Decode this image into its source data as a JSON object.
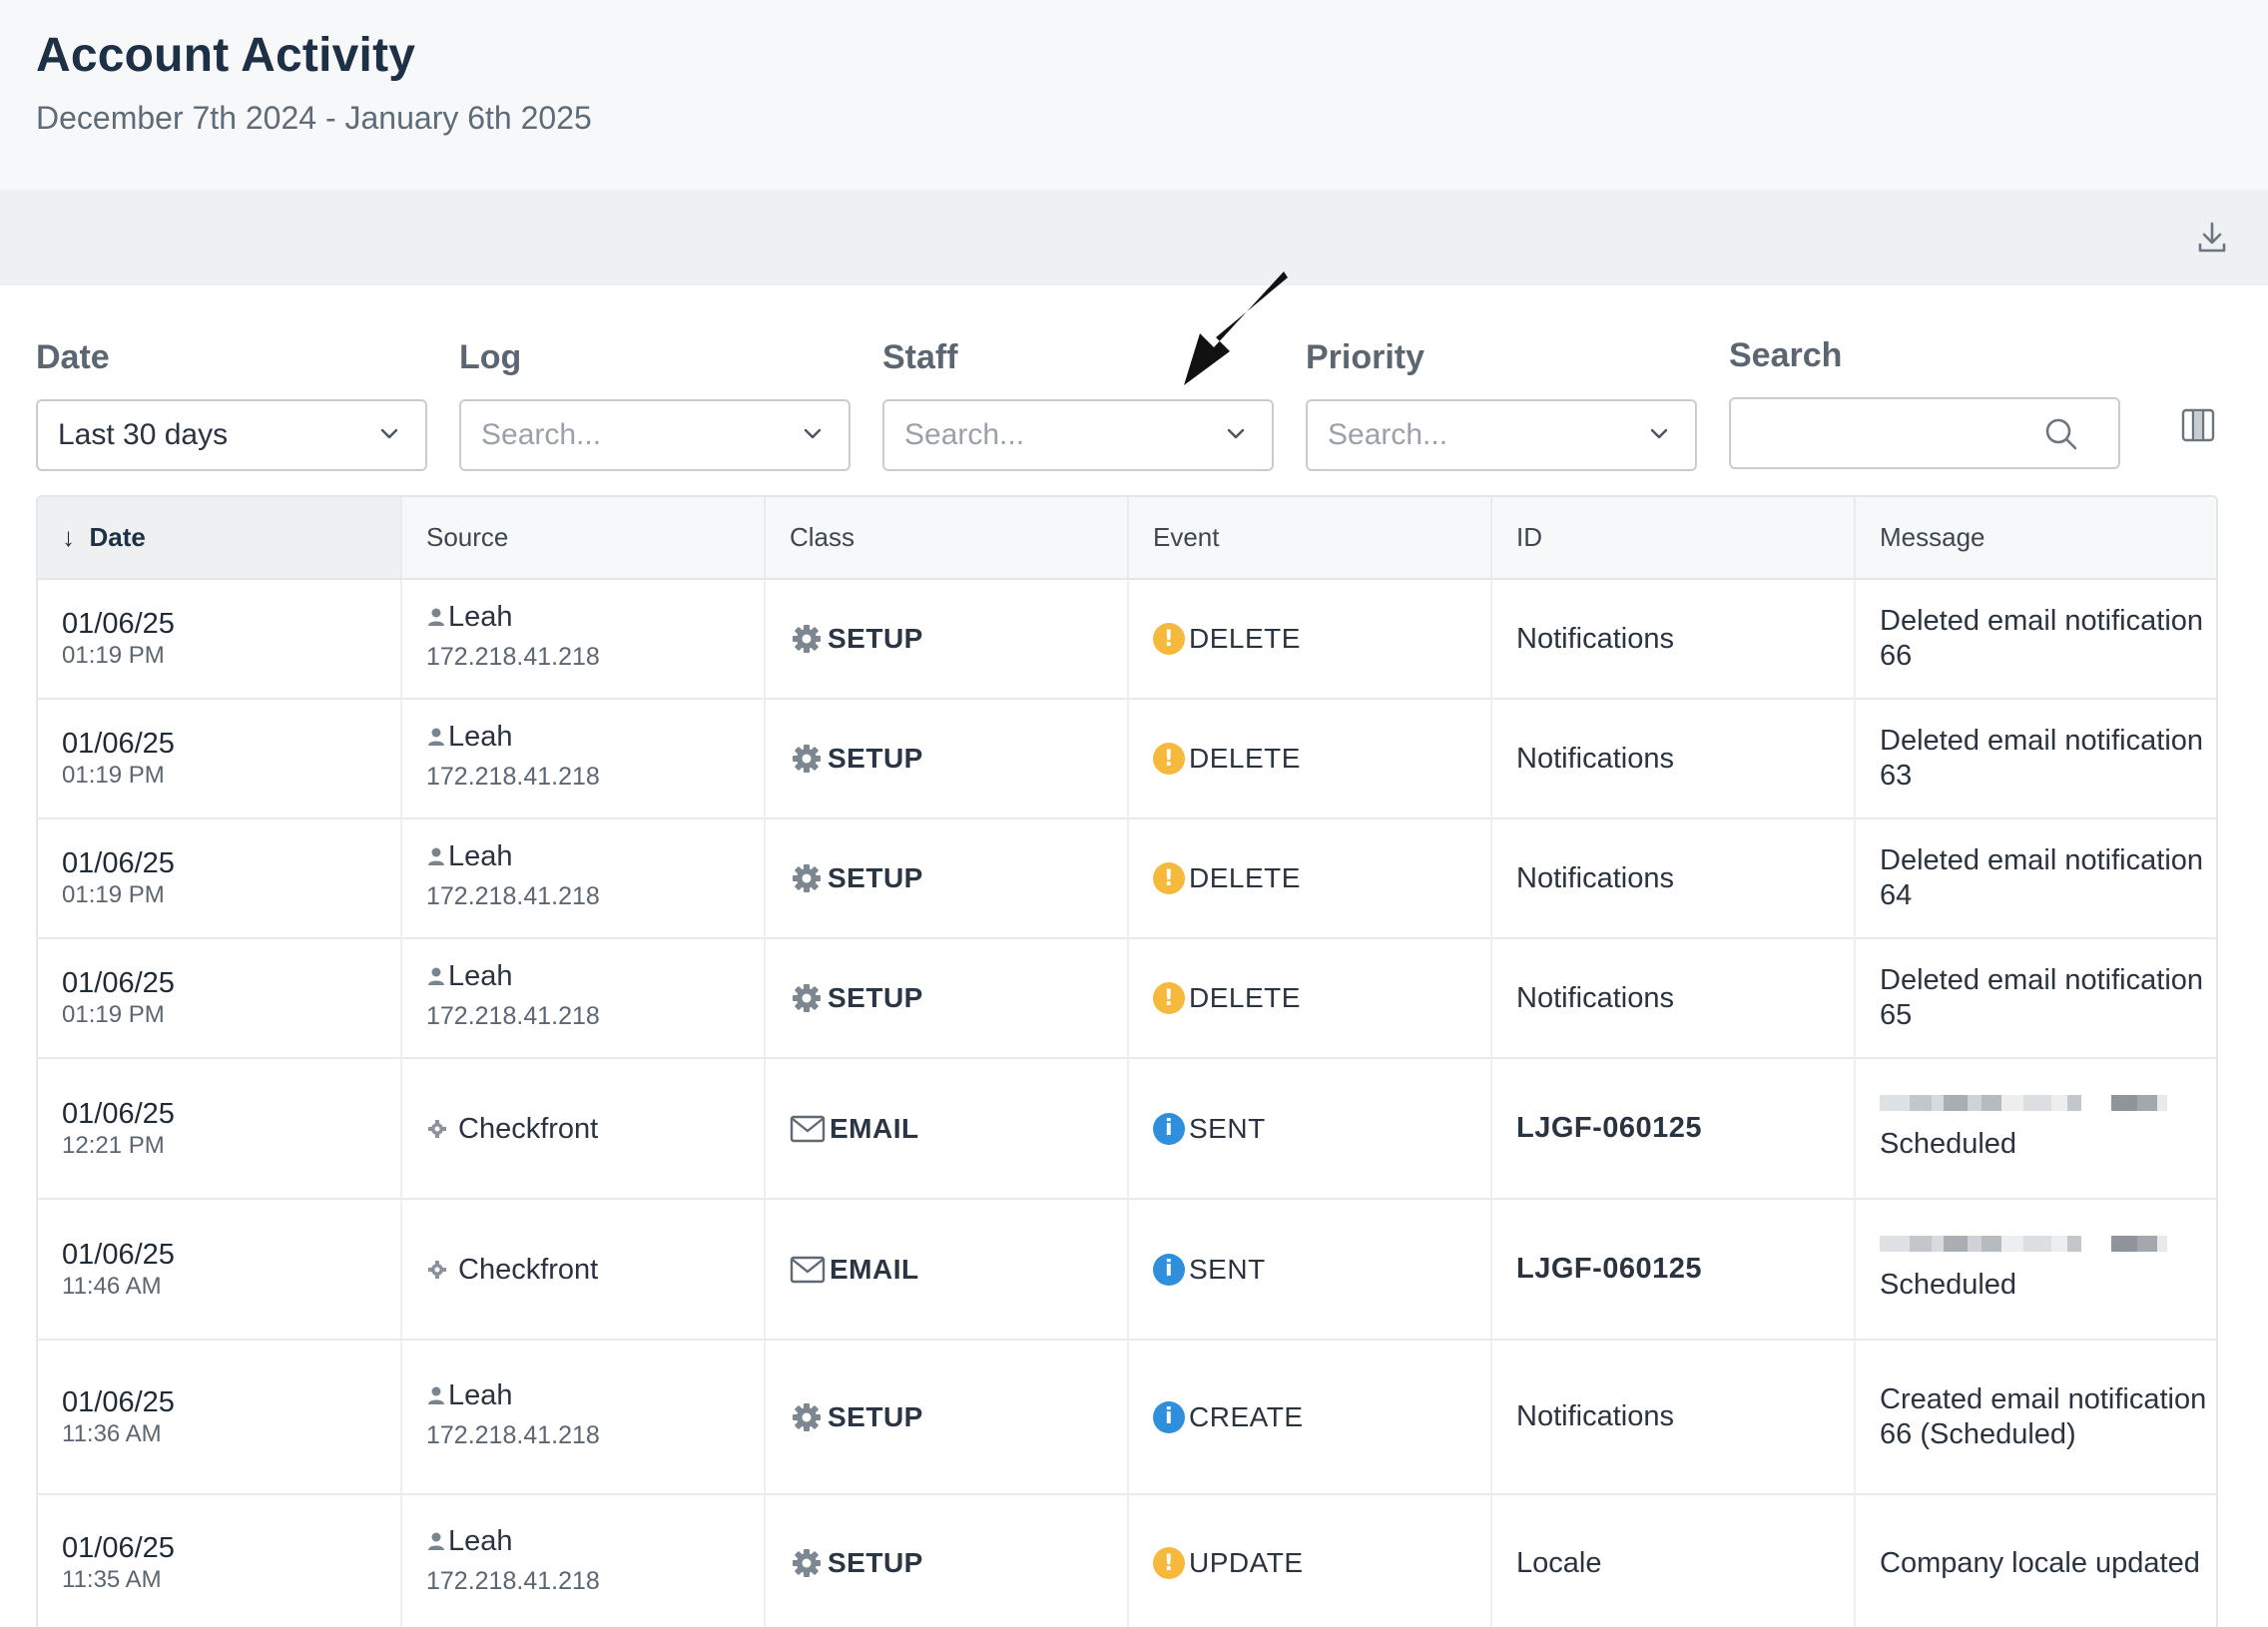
{
  "header": {
    "title": "Account Activity",
    "subtitle": "December 7th 2024 - January 6th 2025"
  },
  "toolbar": {
    "download_icon": "download-icon"
  },
  "filters": {
    "date": {
      "label": "Date",
      "value": "Last 30 days"
    },
    "log": {
      "label": "Log",
      "placeholder": "Search..."
    },
    "staff": {
      "label": "Staff",
      "placeholder": "Search..."
    },
    "priority": {
      "label": "Priority",
      "placeholder": "Search..."
    },
    "search": {
      "label": "Search",
      "value": ""
    }
  },
  "table": {
    "columns": [
      "Date",
      "Source",
      "Class",
      "Event",
      "ID",
      "Message"
    ],
    "sort_indicator": "↓",
    "rows": [
      {
        "date": "01/06/25",
        "time": "01:19 PM",
        "source": "Leah",
        "ip": "172.218.41.218",
        "source_type": "user",
        "class": "SETUP",
        "event": "DELETE",
        "event_level": "warn",
        "id": "Notifications",
        "message": "Deleted email notification 66"
      },
      {
        "date": "01/06/25",
        "time": "01:19 PM",
        "source": "Leah",
        "ip": "172.218.41.218",
        "source_type": "user",
        "class": "SETUP",
        "event": "DELETE",
        "event_level": "warn",
        "id": "Notifications",
        "message": "Deleted email notification 63"
      },
      {
        "date": "01/06/25",
        "time": "01:19 PM",
        "source": "Leah",
        "ip": "172.218.41.218",
        "source_type": "user",
        "class": "SETUP",
        "event": "DELETE",
        "event_level": "warn",
        "id": "Notifications",
        "message": "Deleted email notification 64"
      },
      {
        "date": "01/06/25",
        "time": "01:19 PM",
        "source": "Leah",
        "ip": "172.218.41.218",
        "source_type": "user",
        "class": "SETUP",
        "event": "DELETE",
        "event_level": "warn",
        "id": "Notifications",
        "message": "Deleted email notification 65"
      },
      {
        "date": "01/06/25",
        "time": "12:21 PM",
        "source": "Checkfront",
        "ip": "",
        "source_type": "system",
        "class": "EMAIL",
        "event": "SENT",
        "event_level": "info",
        "id": "LJGF-060125",
        "message": "Scheduled"
      },
      {
        "date": "01/06/25",
        "time": "11:46 AM",
        "source": "Checkfront",
        "ip": "",
        "source_type": "system",
        "class": "EMAIL",
        "event": "SENT",
        "event_level": "info",
        "id": "LJGF-060125",
        "message": "Scheduled"
      },
      {
        "date": "01/06/25",
        "time": "11:36 AM",
        "source": "Leah",
        "ip": "172.218.41.218",
        "source_type": "user",
        "class": "SETUP",
        "event": "CREATE",
        "event_level": "info",
        "id": "Notifications",
        "message": "Created email notification 66 (Scheduled)"
      },
      {
        "date": "01/06/25",
        "time": "11:35 AM",
        "source": "Leah",
        "ip": "172.218.41.218",
        "source_type": "user",
        "class": "SETUP",
        "event": "UPDATE",
        "event_level": "warn",
        "id": "Locale",
        "message": "Company locale updated"
      }
    ]
  },
  "colors": {
    "warn": "#f6b93b",
    "info": "#2f8fdd",
    "title": "#1e3045"
  }
}
